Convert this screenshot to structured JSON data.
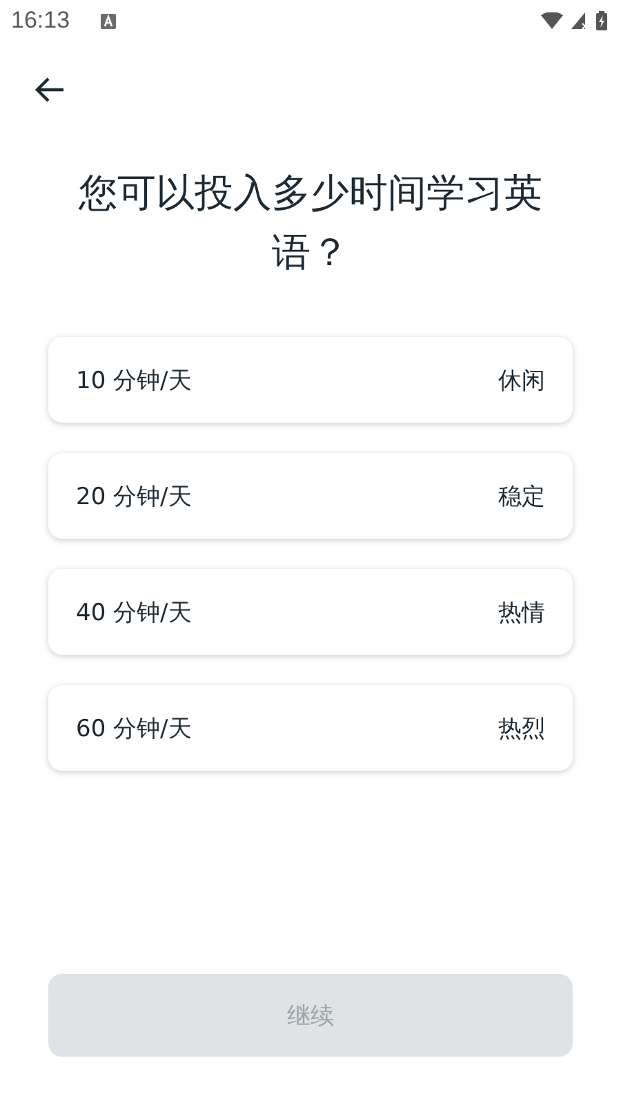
{
  "status_bar": {
    "time": "16:13"
  },
  "title": "您可以投入多少时间学习英语？",
  "options": [
    {
      "duration": "10 分钟/天",
      "label": "休闲",
      "selected": false
    },
    {
      "duration": "20 分钟/天",
      "label": "稳定",
      "selected": false
    },
    {
      "duration": "40 分钟/天",
      "label": "热情",
      "selected": false
    },
    {
      "duration": "60 分钟/天",
      "label": "热烈",
      "selected": false
    }
  ],
  "continue_button": {
    "label": "继续",
    "disabled": true
  }
}
